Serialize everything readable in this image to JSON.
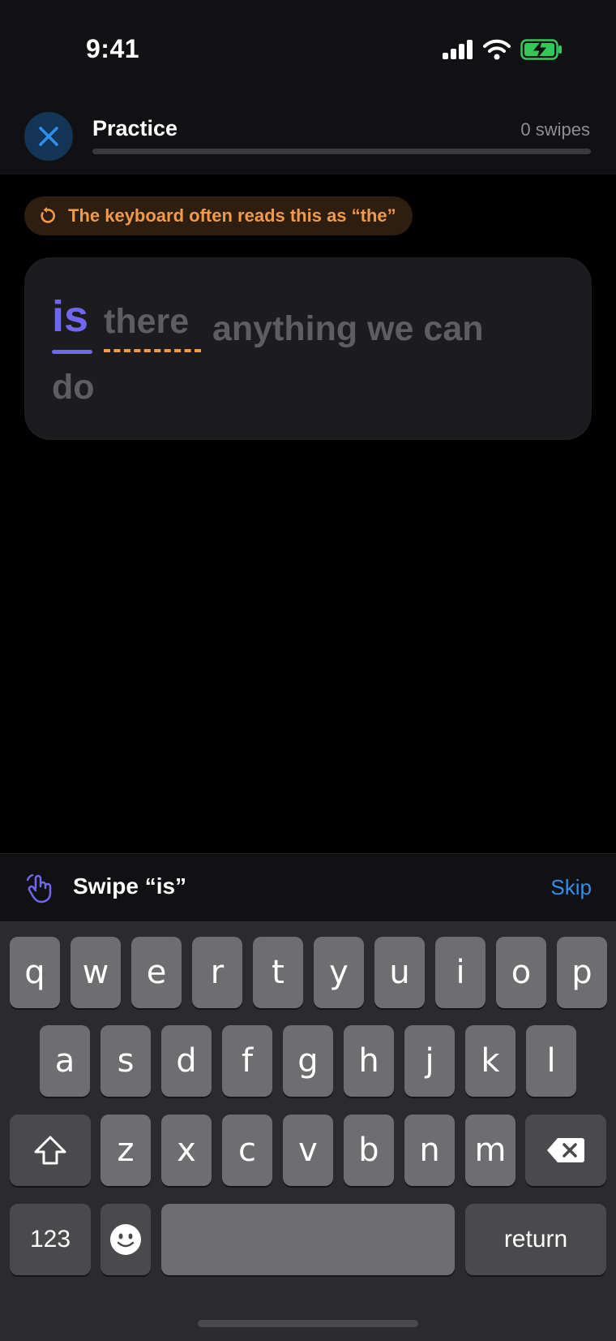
{
  "status_bar": {
    "time": "9:41"
  },
  "header": {
    "title": "Practice",
    "swipe_count": "0 swipes",
    "progress": 0
  },
  "hint": {
    "text": "The keyboard often reads this as “the”"
  },
  "sentence": {
    "active_word": "is",
    "next_word": "there",
    "rest_line1": "anything we can",
    "rest_line2": "do"
  },
  "prompt": {
    "text": "Swipe “is”",
    "skip_label": "Skip"
  },
  "keyboard": {
    "row1": [
      "q",
      "w",
      "e",
      "r",
      "t",
      "y",
      "u",
      "i",
      "o",
      "p"
    ],
    "row2": [
      "a",
      "s",
      "d",
      "f",
      "g",
      "h",
      "j",
      "k",
      "l"
    ],
    "row3": [
      "z",
      "x",
      "c",
      "v",
      "b",
      "n",
      "m"
    ],
    "numbers_label": "123",
    "return_label": "return"
  },
  "colors": {
    "accent": "#6f67f0",
    "warning": "#f2994a",
    "link": "#2f8ff0",
    "close_button": "#133656",
    "battery": "#34c759"
  }
}
